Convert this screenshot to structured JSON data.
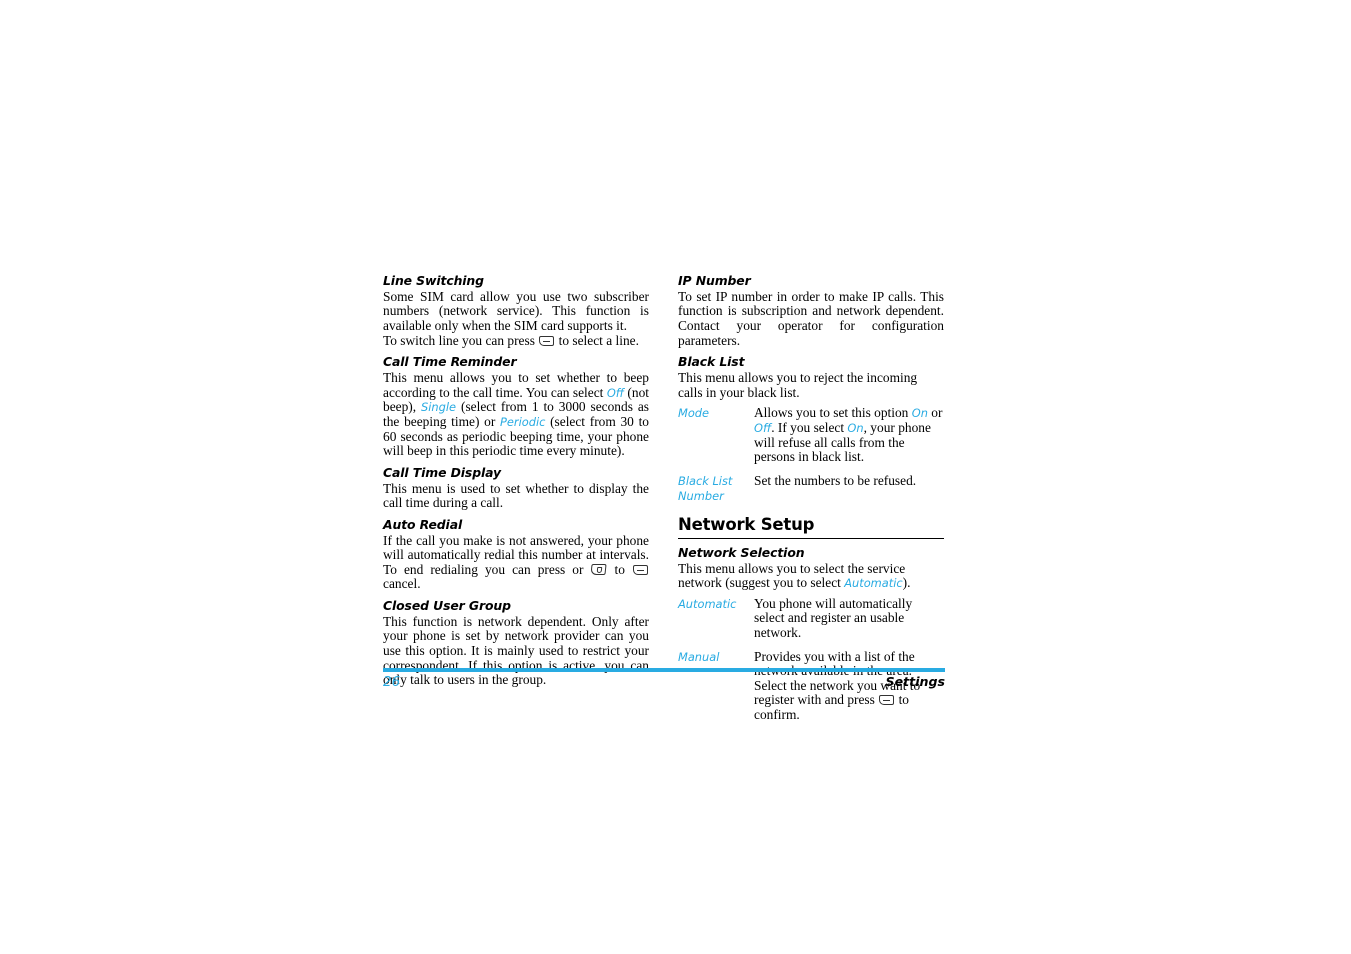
{
  "colors": {
    "accent": "#29abe2",
    "text": "#000000",
    "background": "#ffffff"
  },
  "icons": {
    "soft_key": "soft-key-icon",
    "end_call_key": "end-call-key-icon"
  },
  "left_column": {
    "sections": [
      {
        "heading": "Line Switching",
        "paragraphs": [
          "Some SIM card allow you use two subscriber numbers (network service). This function is available only when the SIM card supports it.",
          "To switch line you can press "
        ],
        "paragraph_tail": " to select a line."
      },
      {
        "heading": "Call Time Reminder",
        "text_1": "This menu allows you to set whether to beep according to the call time. You can select ",
        "kw_1": "Off",
        "text_2": " (not beep), ",
        "kw_2": "Single",
        "text_3": " (select from 1 to 3000 seconds as the beeping time) or ",
        "kw_3": "Periodic",
        "text_4": " (select from 30 to 60 seconds as periodic beeping time, your phone will beep in this periodic time every minute)."
      },
      {
        "heading": "Call Time Display",
        "paragraph": "This menu is used to set whether to display the call time during a call."
      },
      {
        "heading": "Auto Redial",
        "text_1": "If the call you make is not answered, your phone will automatically redial this number at intervals. To end redialing you can press  or ",
        "text_2": " to ",
        "text_3": " cancel."
      },
      {
        "heading": "Closed User Group",
        "paragraph": "This function is network dependent. Only after your phone is set by network provider can you use this option. It is mainly used to restrict your correspondent. If this option is active, you can only talk to users in the group."
      }
    ]
  },
  "right_column": {
    "sections": [
      {
        "heading": "IP Number",
        "paragraph": "To set IP number in order to make IP calls. This function is subscription and network dependent. Contact your operator for configuration parameters."
      },
      {
        "heading": "Black List",
        "paragraph": "This menu allows you to reject the incoming calls in your black list.",
        "definitions": [
          {
            "term": "Mode",
            "desc_1": "Allows you to set this option ",
            "kw_1": "On",
            "desc_2": " or ",
            "kw_2": "Off",
            "desc_3": ". If you select ",
            "kw_3": "On",
            "desc_4": ", your phone will refuse all calls from the persons in black list."
          },
          {
            "term": "Black List Number",
            "desc": "Set the numbers to be refused."
          }
        ]
      }
    ],
    "chapter_heading": "Network Setup",
    "network_selection": {
      "heading": "Network Selection",
      "text_1": "This menu allows you to select the service network (suggest you to select ",
      "kw_1": "Automatic",
      "text_2": ").",
      "definitions": [
        {
          "term": "Automatic",
          "desc": "You phone will automatically select and register an usable network."
        },
        {
          "term": "Manual",
          "desc_1": "Provides you with a list of the network available in the area. Select the network you want to register with and press ",
          "desc_2": " to confirm."
        }
      ]
    }
  },
  "footer": {
    "page_number": "26",
    "chapter_tag": "Settings"
  }
}
